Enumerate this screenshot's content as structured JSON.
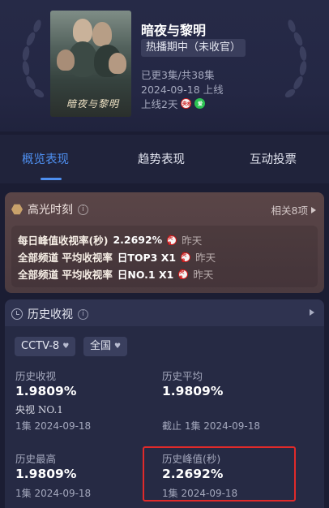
{
  "show": {
    "title": "暗夜与黎明",
    "status": "热播期中（未收官）",
    "episodes": "已更3集/共38集",
    "air_date": "2024-09-18 上线",
    "days_online": "上线2天",
    "poster_title": "暗夜与黎明"
  },
  "tabs": [
    "概览表现",
    "趋势表现",
    "互动投票"
  ],
  "highlights": {
    "title": "高光时刻",
    "related": "相关8项",
    "rows": [
      {
        "text": "每日峰值收视率(秒)",
        "value": "2.2692%",
        "when": "昨天"
      },
      {
        "text": "全部频道 平均收视率",
        "value": "日TOP3 X1",
        "when": "昨天"
      },
      {
        "text": "全部频道 平均收视率",
        "value": "日NO.1 X1",
        "when": "昨天"
      }
    ]
  },
  "history": {
    "title": "历史收视",
    "filters": [
      "CCTV-8",
      "全国"
    ],
    "stats": [
      {
        "label": "历史收视",
        "value": "1.9809%",
        "sub": "央视 NO.1",
        "sub2": "1集 2024-09-18"
      },
      {
        "label": "历史平均",
        "value": "1.9809%",
        "sub": "截止 1集 2024-09-18"
      },
      {
        "label": "历史最高",
        "value": "1.9809%",
        "sub": "1集 2024-09-18"
      },
      {
        "label": "历史峰值(秒)",
        "value": "2.2692%",
        "sub": "1集 2024-09-18"
      }
    ]
  },
  "logos": {
    "cctv": "央8",
    "iqiyi": "爱"
  },
  "colors": {
    "accent": "#4e8ff0",
    "highlight_box": "#e02a2a"
  }
}
